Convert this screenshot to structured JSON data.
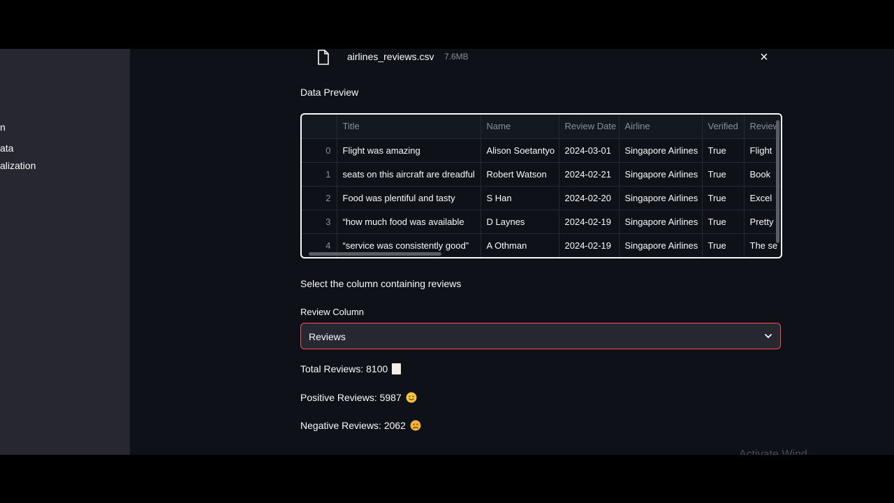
{
  "sidebar": {
    "items": [
      {
        "label": "n"
      },
      {
        "label": "ata"
      },
      {
        "label": "alization"
      }
    ]
  },
  "file": {
    "name": "airlines_reviews.csv",
    "size": "7.6MB",
    "close_icon": "close-icon"
  },
  "preview": {
    "heading": "Data Preview",
    "columns": [
      "",
      "Title",
      "Name",
      "Review Date",
      "Airline",
      "Verified",
      "Review"
    ],
    "rows": [
      {
        "index": "0",
        "title": "Flight was amazing",
        "name": "Alison Soetantyo",
        "date": "2024-03-01",
        "airline": "Singapore Airlines",
        "verified": "True",
        "review": "Flight"
      },
      {
        "index": "1",
        "title": "seats on this aircraft are dreadful",
        "name": "Robert Watson",
        "date": "2024-02-21",
        "airline": "Singapore Airlines",
        "verified": "True",
        "review": "Book"
      },
      {
        "index": "2",
        "title": "Food was plentiful and tasty",
        "name": "S Han",
        "date": "2024-02-20",
        "airline": "Singapore Airlines",
        "verified": "True",
        "review": "Excel"
      },
      {
        "index": "3",
        "title": "“how much food was available",
        "name": "D Laynes",
        "date": "2024-02-19",
        "airline": "Singapore Airlines",
        "verified": "True",
        "review": "Pretty"
      },
      {
        "index": "4",
        "title": "“service was consistently good”",
        "name": "A Othman",
        "date": "2024-02-19",
        "airline": "Singapore Airlines",
        "verified": "True",
        "review": "The se"
      }
    ]
  },
  "select": {
    "prompt": "Select the column containing reviews",
    "label": "Review Column",
    "value": "Reviews",
    "accent": "#ff4b4b"
  },
  "stats": {
    "total": "Total Reviews: 8100",
    "positive": "Positive Reviews: 5987",
    "negative": "Negative Reviews: 2062"
  },
  "watermark": "Activate Wind"
}
